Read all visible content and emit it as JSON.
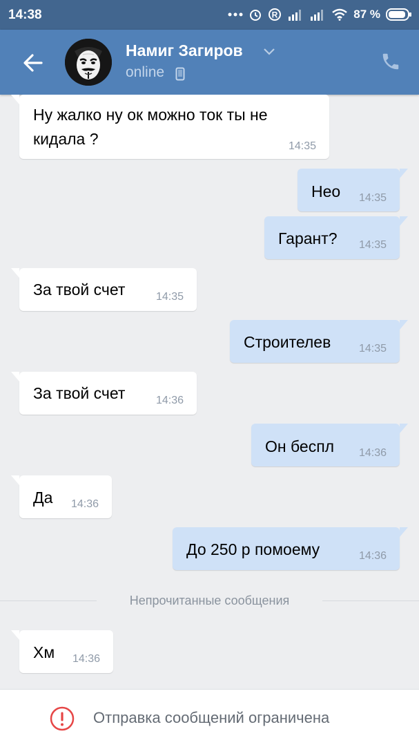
{
  "status_bar": {
    "time": "14:38",
    "battery": "87 %"
  },
  "header": {
    "contact_name": "Намиг Загиров",
    "contact_status": "online"
  },
  "messages": [
    {
      "dir": "in",
      "text": "Ну жалко ну ок можно ток ты не",
      "text2": "кидала ?",
      "time": "14:35"
    },
    {
      "dir": "out",
      "text": "Нео",
      "time": "14:35"
    },
    {
      "dir": "out",
      "text": "Гарант?",
      "time": "14:35"
    },
    {
      "dir": "in",
      "text": "За твой счет",
      "time": "14:35"
    },
    {
      "dir": "out",
      "text": "Строителев",
      "time": "14:35"
    },
    {
      "dir": "in",
      "text": "За твой счет",
      "time": "14:36"
    },
    {
      "dir": "out",
      "text": "Он беспл",
      "time": "14:36"
    },
    {
      "dir": "in",
      "text": "Да",
      "time": "14:36"
    },
    {
      "dir": "out",
      "text": "До 250 р помоему",
      "time": "14:36"
    },
    {
      "dir": "in",
      "text": "Хм",
      "time": "14:36"
    }
  ],
  "unread_divider": "Непрочитанные сообщения",
  "footer": {
    "notice": "Отправка сообщений ограничена"
  },
  "colors": {
    "header_bg": "#5181b8",
    "status_bg": "#42668f",
    "chat_bg": "#edeef0",
    "incoming_bubble": "#ffffff",
    "outgoing_bubble": "#cfe1f7",
    "warning": "#e64646"
  },
  "icons": [
    "back-arrow-icon",
    "avatar",
    "chevron-down-icon",
    "mobile-phone-icon",
    "call-icon",
    "warning-icon"
  ]
}
